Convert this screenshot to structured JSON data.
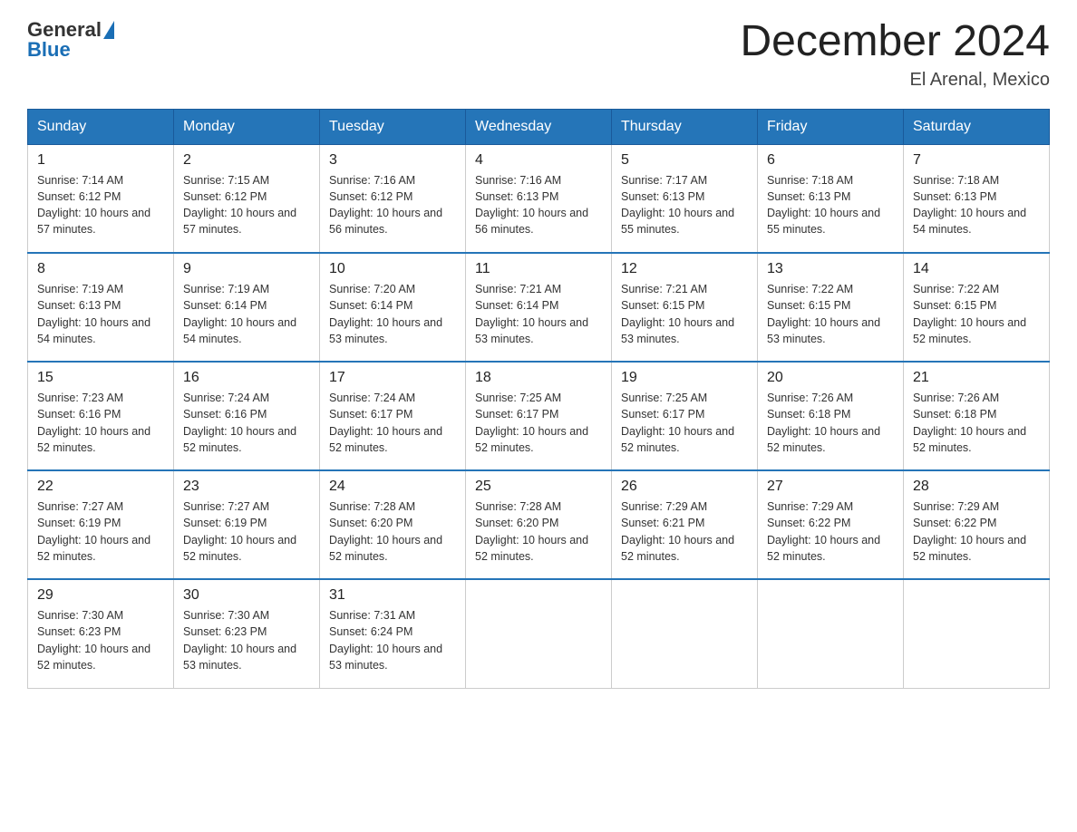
{
  "logo": {
    "text_general": "General",
    "text_blue": "Blue"
  },
  "title": {
    "month_year": "December 2024",
    "location": "El Arenal, Mexico"
  },
  "headers": [
    "Sunday",
    "Monday",
    "Tuesday",
    "Wednesday",
    "Thursday",
    "Friday",
    "Saturday"
  ],
  "weeks": [
    [
      {
        "day": "1",
        "sunrise": "7:14 AM",
        "sunset": "6:12 PM",
        "daylight": "10 hours and 57 minutes."
      },
      {
        "day": "2",
        "sunrise": "7:15 AM",
        "sunset": "6:12 PM",
        "daylight": "10 hours and 57 minutes."
      },
      {
        "day": "3",
        "sunrise": "7:16 AM",
        "sunset": "6:12 PM",
        "daylight": "10 hours and 56 minutes."
      },
      {
        "day": "4",
        "sunrise": "7:16 AM",
        "sunset": "6:13 PM",
        "daylight": "10 hours and 56 minutes."
      },
      {
        "day": "5",
        "sunrise": "7:17 AM",
        "sunset": "6:13 PM",
        "daylight": "10 hours and 55 minutes."
      },
      {
        "day": "6",
        "sunrise": "7:18 AM",
        "sunset": "6:13 PM",
        "daylight": "10 hours and 55 minutes."
      },
      {
        "day": "7",
        "sunrise": "7:18 AM",
        "sunset": "6:13 PM",
        "daylight": "10 hours and 54 minutes."
      }
    ],
    [
      {
        "day": "8",
        "sunrise": "7:19 AM",
        "sunset": "6:13 PM",
        "daylight": "10 hours and 54 minutes."
      },
      {
        "day": "9",
        "sunrise": "7:19 AM",
        "sunset": "6:14 PM",
        "daylight": "10 hours and 54 minutes."
      },
      {
        "day": "10",
        "sunrise": "7:20 AM",
        "sunset": "6:14 PM",
        "daylight": "10 hours and 53 minutes."
      },
      {
        "day": "11",
        "sunrise": "7:21 AM",
        "sunset": "6:14 PM",
        "daylight": "10 hours and 53 minutes."
      },
      {
        "day": "12",
        "sunrise": "7:21 AM",
        "sunset": "6:15 PM",
        "daylight": "10 hours and 53 minutes."
      },
      {
        "day": "13",
        "sunrise": "7:22 AM",
        "sunset": "6:15 PM",
        "daylight": "10 hours and 53 minutes."
      },
      {
        "day": "14",
        "sunrise": "7:22 AM",
        "sunset": "6:15 PM",
        "daylight": "10 hours and 52 minutes."
      }
    ],
    [
      {
        "day": "15",
        "sunrise": "7:23 AM",
        "sunset": "6:16 PM",
        "daylight": "10 hours and 52 minutes."
      },
      {
        "day": "16",
        "sunrise": "7:24 AM",
        "sunset": "6:16 PM",
        "daylight": "10 hours and 52 minutes."
      },
      {
        "day": "17",
        "sunrise": "7:24 AM",
        "sunset": "6:17 PM",
        "daylight": "10 hours and 52 minutes."
      },
      {
        "day": "18",
        "sunrise": "7:25 AM",
        "sunset": "6:17 PM",
        "daylight": "10 hours and 52 minutes."
      },
      {
        "day": "19",
        "sunrise": "7:25 AM",
        "sunset": "6:17 PM",
        "daylight": "10 hours and 52 minutes."
      },
      {
        "day": "20",
        "sunrise": "7:26 AM",
        "sunset": "6:18 PM",
        "daylight": "10 hours and 52 minutes."
      },
      {
        "day": "21",
        "sunrise": "7:26 AM",
        "sunset": "6:18 PM",
        "daylight": "10 hours and 52 minutes."
      }
    ],
    [
      {
        "day": "22",
        "sunrise": "7:27 AM",
        "sunset": "6:19 PM",
        "daylight": "10 hours and 52 minutes."
      },
      {
        "day": "23",
        "sunrise": "7:27 AM",
        "sunset": "6:19 PM",
        "daylight": "10 hours and 52 minutes."
      },
      {
        "day": "24",
        "sunrise": "7:28 AM",
        "sunset": "6:20 PM",
        "daylight": "10 hours and 52 minutes."
      },
      {
        "day": "25",
        "sunrise": "7:28 AM",
        "sunset": "6:20 PM",
        "daylight": "10 hours and 52 minutes."
      },
      {
        "day": "26",
        "sunrise": "7:29 AM",
        "sunset": "6:21 PM",
        "daylight": "10 hours and 52 minutes."
      },
      {
        "day": "27",
        "sunrise": "7:29 AM",
        "sunset": "6:22 PM",
        "daylight": "10 hours and 52 minutes."
      },
      {
        "day": "28",
        "sunrise": "7:29 AM",
        "sunset": "6:22 PM",
        "daylight": "10 hours and 52 minutes."
      }
    ],
    [
      {
        "day": "29",
        "sunrise": "7:30 AM",
        "sunset": "6:23 PM",
        "daylight": "10 hours and 52 minutes."
      },
      {
        "day": "30",
        "sunrise": "7:30 AM",
        "sunset": "6:23 PM",
        "daylight": "10 hours and 53 minutes."
      },
      {
        "day": "31",
        "sunrise": "7:31 AM",
        "sunset": "6:24 PM",
        "daylight": "10 hours and 53 minutes."
      },
      null,
      null,
      null,
      null
    ]
  ]
}
